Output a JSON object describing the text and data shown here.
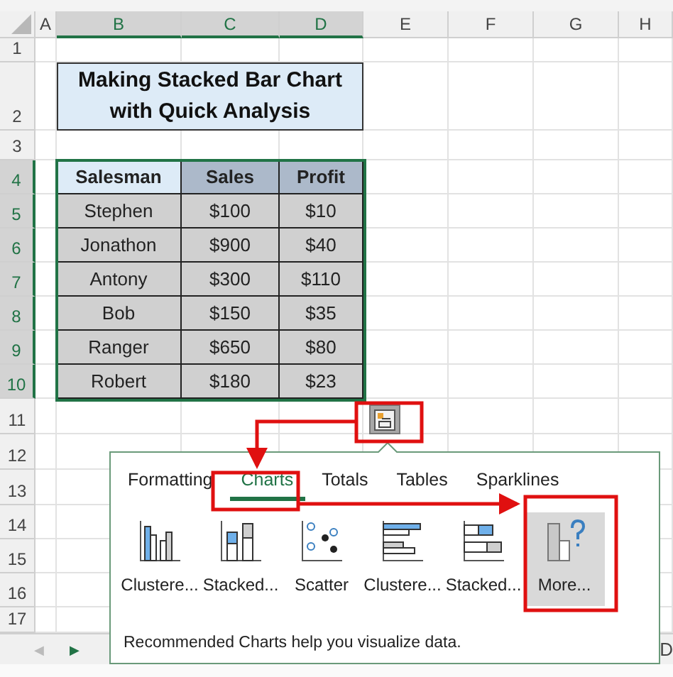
{
  "columns": [
    {
      "label": "A",
      "selected": false
    },
    {
      "label": "B",
      "selected": true
    },
    {
      "label": "C",
      "selected": true
    },
    {
      "label": "D",
      "selected": true
    },
    {
      "label": "E",
      "selected": false
    },
    {
      "label": "F",
      "selected": false
    },
    {
      "label": "G",
      "selected": false
    },
    {
      "label": "H",
      "selected": false
    }
  ],
  "rows": [
    {
      "label": "1",
      "selected": false
    },
    {
      "label": "2",
      "selected": false
    },
    {
      "label": "3",
      "selected": false
    },
    {
      "label": "4",
      "selected": true
    },
    {
      "label": "5",
      "selected": true
    },
    {
      "label": "6",
      "selected": true
    },
    {
      "label": "7",
      "selected": true
    },
    {
      "label": "8",
      "selected": true
    },
    {
      "label": "9",
      "selected": true
    },
    {
      "label": "10",
      "selected": true
    },
    {
      "label": "11",
      "selected": false
    },
    {
      "label": "12",
      "selected": false
    },
    {
      "label": "13",
      "selected": false
    },
    {
      "label": "14",
      "selected": false
    },
    {
      "label": "15",
      "selected": false
    },
    {
      "label": "16",
      "selected": false
    },
    {
      "label": "17",
      "selected": false
    }
  ],
  "title": [
    "Making Stacked Bar Chart",
    "with Quick Analysis"
  ],
  "table": {
    "columns": [
      "Salesman",
      "Sales",
      "Profit"
    ],
    "rows": [
      [
        "Stephen",
        "$100",
        "$10"
      ],
      [
        "Jonathon",
        "$900",
        "$40"
      ],
      [
        "Antony",
        "$300",
        "$110"
      ],
      [
        "Bob",
        "$150",
        "$35"
      ],
      [
        "Ranger",
        "$650",
        "$80"
      ],
      [
        "Robert",
        "$180",
        "$23"
      ]
    ]
  },
  "quick_analysis": {
    "tabs": [
      {
        "label": "Formatting",
        "selected": false
      },
      {
        "label": "Charts",
        "selected": true
      },
      {
        "label": "Totals",
        "selected": false
      },
      {
        "label": "Tables",
        "selected": false
      },
      {
        "label": "Sparklines",
        "selected": false
      }
    ],
    "items": [
      {
        "kind": "clustered-column",
        "label": "Clustere...",
        "selected": false
      },
      {
        "kind": "stacked-column",
        "label": "Stacked...",
        "selected": false
      },
      {
        "kind": "scatter",
        "label": "Scatter",
        "selected": false
      },
      {
        "kind": "clustered-bar",
        "label": "Clustere...",
        "selected": false
      },
      {
        "kind": "stacked-bar",
        "label": "Stacked...",
        "selected": false
      },
      {
        "kind": "more",
        "label": "More...",
        "selected": true
      }
    ],
    "footer": "Recommended Charts help you visualize data."
  },
  "sheet_bar": {
    "nav": [
      "◀",
      "▶"
    ],
    "edge_text": "D"
  }
}
